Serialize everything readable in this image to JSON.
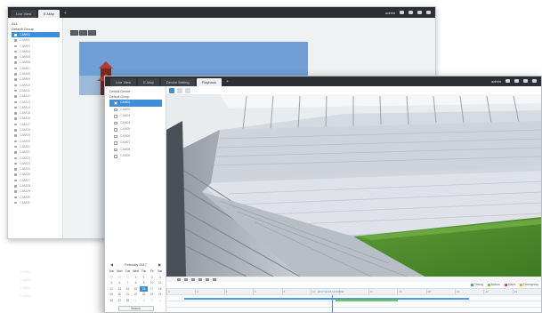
{
  "back_window": {
    "tabs": [
      "Live View",
      "E-Map"
    ],
    "add_tab": "+",
    "user": "admin",
    "tree_root": "ALL",
    "tree_group": "Default Group",
    "cameras": [
      "CAM01",
      "CAM02",
      "CAM03",
      "CAM04",
      "CAM05",
      "CAM06",
      "CAM07",
      "CAM08",
      "CAM09",
      "CAM10",
      "CAM11",
      "CAM12",
      "CAM13",
      "CAM14",
      "CAM15",
      "CAM16",
      "CAM17",
      "CAM18",
      "CAM19",
      "CAM20",
      "CAM21",
      "CAM22",
      "CAM23",
      "CAM24",
      "CAM25",
      "CAM26",
      "CAM27",
      "CAM28",
      "CAM29",
      "CAM30",
      "CAM31"
    ],
    "selected_index": 0
  },
  "front_window": {
    "tabs": [
      "Live View",
      "E-Map",
      "Device Setting",
      "Playback"
    ],
    "add_tab": "+",
    "active_tab": 3,
    "user": "admin",
    "tree_root": "Default Device",
    "tree_group": "Default Group",
    "cameras": [
      "CAM01",
      "CAM02",
      "CAM03",
      "CAM04",
      "CAM05",
      "CAM06",
      "CAM07",
      "CAM08",
      "CAM09"
    ],
    "selected_index": 0,
    "calendar": {
      "prev": "◀",
      "next": "▶",
      "month_label": "February  2017",
      "weekdays": [
        "Sun",
        "Mon",
        "Tue",
        "Wed",
        "Thu",
        "Fri",
        "Sat"
      ],
      "days": [
        "29",
        "30",
        "31",
        "1",
        "2",
        "3",
        "4",
        "5",
        "6",
        "7",
        "8",
        "9",
        "10",
        "11",
        "12",
        "13",
        "14",
        "15",
        "16",
        "17",
        "18",
        "19",
        "20",
        "21",
        "22",
        "23",
        "24",
        "25",
        "26",
        "27",
        "28",
        "1",
        "2",
        "3",
        "4"
      ],
      "today_index": 18,
      "search_label": "Search"
    },
    "timeline": {
      "date": "2017-02-16  12:00:00",
      "hours": [
        "0",
        "2",
        "4",
        "6",
        "8",
        "10",
        "12",
        "14",
        "16",
        "18",
        "20",
        "22",
        "24"
      ]
    },
    "legend": [
      {
        "label": "Timing",
        "color": "#4c9be8"
      },
      {
        "label": "Motion",
        "color": "#7ac943"
      },
      {
        "label": "Alarm",
        "color": "#e84c3d"
      },
      {
        "label": "Emergency",
        "color": "#f5a623"
      }
    ],
    "colors": {
      "accent": "#3e8fd8",
      "titlebar": "#2b2e33"
    }
  },
  "ghost_list": [
    "CAM01",
    "CAM02",
    "CAM03",
    "CAM04"
  ]
}
